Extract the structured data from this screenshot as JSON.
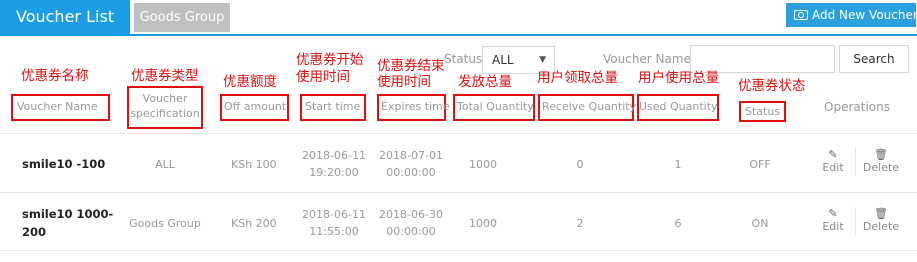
{
  "tabs": {
    "active": "Voucher List",
    "inactive": "Goods Group"
  },
  "add_button": "Add New Voucher",
  "filters": {
    "status_label": "Status",
    "status_value": "ALL",
    "name_label": "Voucher Name",
    "name_value": "",
    "search_button": "Search"
  },
  "annotations": {
    "voucher_name": "优惠券名称",
    "voucher_spec": "优惠券类型",
    "off_amount": "优惠额度",
    "start_time_1": "优惠券开始",
    "start_time_2": "使用时间",
    "expires_time_1": "优惠券结束",
    "expires_time_2": "使用时间",
    "total_qty": "发放总量",
    "receive_qty": "用户领取总量",
    "used_qty": "用户使用总量",
    "status": "优惠券状态"
  },
  "columns": {
    "voucher_name": "Voucher Name",
    "voucher_spec_1": "Voucher",
    "voucher_spec_2": "specification",
    "off_amount": "Off amount",
    "start_time": "Start time",
    "expires_time": "Expires time",
    "total_qty": "Total Quantity",
    "receive_qty": "Receive Quantity",
    "used_qty": "Used Quantity",
    "status": "Status",
    "operations": "Operations"
  },
  "rows": [
    {
      "name_1": "smile10 -100",
      "name_2": "",
      "spec": "ALL",
      "amount": "KSh 100",
      "start_date": "2018-06-11",
      "start_time": "19:20:00",
      "end_date": "2018-07-01",
      "end_time": "00:00:00",
      "total": "1000",
      "received": "0",
      "used": "1",
      "status": "OFF"
    },
    {
      "name_1": "smile10 1000-",
      "name_2": "200",
      "spec": "Goods Group",
      "amount": "KSh 200",
      "start_date": "2018-06-11",
      "start_time": "11:55:00",
      "end_date": "2018-06-30",
      "end_time": "00:00:00",
      "total": "1000",
      "received": "2",
      "used": "6",
      "status": "ON"
    }
  ],
  "operations": {
    "edit": "Edit",
    "delete": "Delete"
  }
}
